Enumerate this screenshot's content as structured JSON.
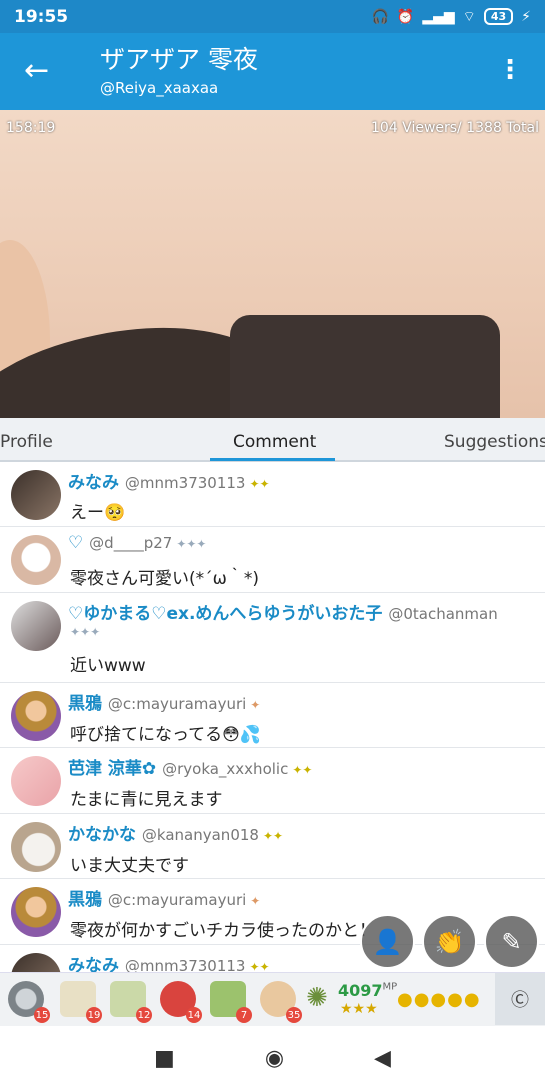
{
  "status": {
    "time": "19:55",
    "battery": "43"
  },
  "header": {
    "title": "ザアザア 零夜",
    "handle": "@Reiya_xaaxaa"
  },
  "video": {
    "elapsed": "158:19",
    "viewers": "104 Viewers/ 1388 Total"
  },
  "tabs": [
    {
      "label": "Profile"
    },
    {
      "label": "Comment"
    },
    {
      "label": "Suggestions"
    }
  ],
  "comments": [
    {
      "name": "みなみ",
      "id": "@mnm3730113",
      "text": "えー🥺"
    },
    {
      "name": "♡",
      "id": "@d____p27",
      "text": "零夜さん可愛い(*´ω｀*)"
    },
    {
      "name": "♡ゆかまる♡ex.めんへらゆうがいおた子",
      "id": "@0tachanman",
      "text": "近いwww"
    },
    {
      "name": "黒鴉",
      "id": "@c:mayuramayuri",
      "text": "呼び捨てになってる😳💦"
    },
    {
      "name": "芭津 涼華",
      "id": "@ryoka_xxxholic",
      "text": "たまに青に見えます"
    },
    {
      "name": "かなかな",
      "id": "@kananyan018",
      "text": "いま大丈夫です"
    },
    {
      "name": "黒鴉",
      "id": "@c:mayuramayuri",
      "text": "零夜が何かすごいチカラ使ったのかと！"
    },
    {
      "name": "みなみ",
      "id": "@mnm3730113",
      "text": ""
    }
  ],
  "gifts": [
    {
      "icon": "coin-gift-icon",
      "count": "15"
    },
    {
      "icon": "tea-100-gift-icon",
      "count": "19"
    },
    {
      "icon": "tea-50-gift-icon",
      "count": "12"
    },
    {
      "icon": "meat-gift-icon",
      "count": "14"
    },
    {
      "icon": "tea-10-gift-icon",
      "count": "7"
    },
    {
      "icon": "clap-gift-icon",
      "count": "35"
    }
  ],
  "points": {
    "value": "4097",
    "unit": "MP",
    "stars": "★★★"
  },
  "colors": {
    "accent": "#1e96d8",
    "status": "#1e88c8"
  }
}
